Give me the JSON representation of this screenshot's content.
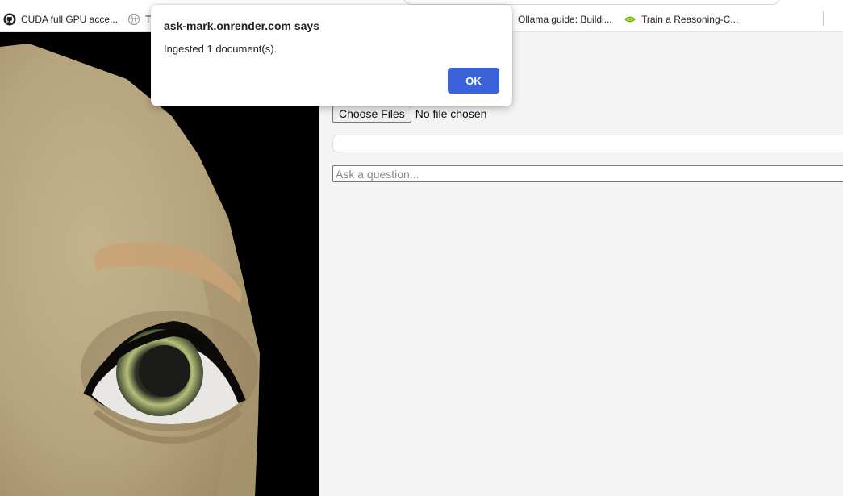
{
  "bookmarks": [
    {
      "label": "CUDA full GPU acce...",
      "icon": "github-icon"
    },
    {
      "label": "Tr",
      "icon": "globe-icon"
    },
    {
      "label": "Ollama guide: Buildi...",
      "icon": "page-icon"
    },
    {
      "label": "Train a Reasoning-C...",
      "icon": "nvidia-icon"
    }
  ],
  "dialog": {
    "title": "ask-mark.onrender.com says",
    "message": "Ingested 1 document(s).",
    "ok_label": "OK"
  },
  "upload": {
    "button_label": "Choose Files",
    "status": "No file chosen"
  },
  "question": {
    "placeholder": "Ask a question...",
    "value": ""
  },
  "colors": {
    "accent": "#3b62db",
    "panel_background": "#f4f4f4",
    "viewport_background": "#000000",
    "skin": "#b9a883",
    "eyebrow": "#c9a275",
    "iris": "#4f5a3d"
  }
}
